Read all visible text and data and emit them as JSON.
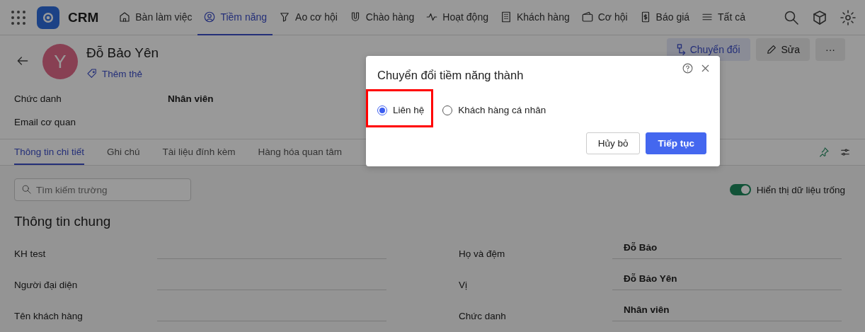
{
  "nav": {
    "brand": "CRM",
    "items": [
      {
        "label": "Bàn làm việc",
        "selected": false
      },
      {
        "label": "Tiềm năng",
        "selected": true
      },
      {
        "label": "Ao cơ hội",
        "selected": false
      },
      {
        "label": "Chào hàng",
        "selected": false
      },
      {
        "label": "Hoạt động",
        "selected": false
      },
      {
        "label": "Khách hàng",
        "selected": false
      },
      {
        "label": "Cơ hội",
        "selected": false
      },
      {
        "label": "Báo giá",
        "selected": false
      },
      {
        "label": "Tất cả",
        "selected": false
      }
    ]
  },
  "record": {
    "avatar": "Y",
    "name": "Đỗ Bảo Yên",
    "add_tag": "Thêm thẻ",
    "actions": [
      {
        "label": "Chuyển đổi",
        "kind": "convert"
      },
      {
        "label": "Sửa",
        "kind": "edit"
      },
      {
        "label": "···",
        "kind": "more"
      }
    ],
    "summary": [
      {
        "label": "Chức danh",
        "value": "Nhân viên"
      },
      {
        "label": "Email cơ quan"
      }
    ]
  },
  "tabs": [
    {
      "label": "Thông tin chi tiết",
      "selected": true
    },
    {
      "label": "Ghi chú",
      "selected": false
    },
    {
      "label": "Tài liệu đính kèm",
      "selected": false
    },
    {
      "label": "Hàng hóa quan tâm",
      "selected": false
    }
  ],
  "search": {
    "placeholder": "Tìm kiếm trường"
  },
  "toggle": {
    "label": "Hiển thị dữ liệu trống",
    "on": true
  },
  "section": {
    "title": "Thông tin chung",
    "left": [
      {
        "label": "KH test"
      },
      {
        "label": "Người đại diện"
      },
      {
        "label": "Tên khách hàng"
      }
    ],
    "right": [
      {
        "label": "Họ và đệm",
        "value": "Đỗ Bảo"
      },
      {
        "label": "Vị",
        "value": "Đỗ Bảo Yên"
      },
      {
        "label": "Chức danh",
        "value": "Nhân viên"
      }
    ]
  },
  "dialog": {
    "title": "Chuyển đổi tiềm năng thành",
    "options": [
      {
        "label": "Liên hệ",
        "selected": true
      },
      {
        "label": "Khách hàng cá nhân",
        "selected": false
      }
    ],
    "buttons": [
      {
        "label": "Hủy bỏ",
        "kind": "secondary"
      },
      {
        "label": "Tiếp tục",
        "kind": "primary"
      }
    ]
  }
}
